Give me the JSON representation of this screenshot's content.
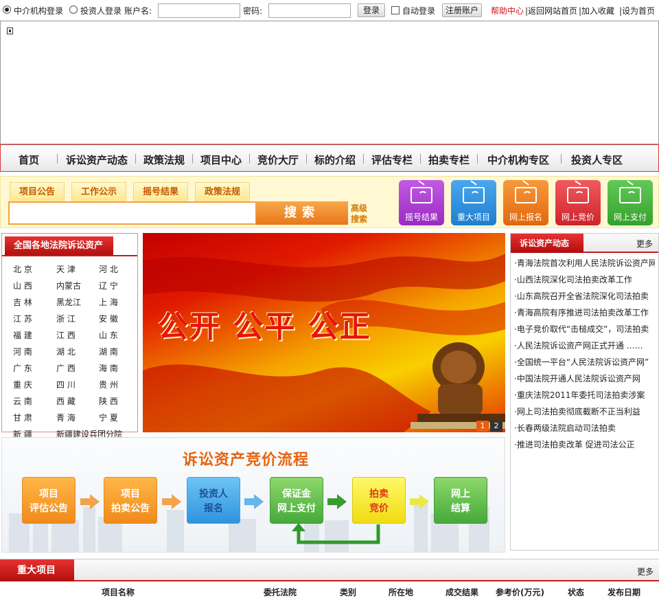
{
  "login": {
    "radio_agency": "中介机构登录",
    "radio_investor": "投资人登录",
    "account_label": "账户名:",
    "password_label": "密码:",
    "login_button": "登录",
    "auto_login": "自动登录",
    "register_button": "注册账户"
  },
  "top_links": [
    "帮助中心",
    "|返回网站首页",
    "|加入收藏",
    "|设为首页"
  ],
  "nav": [
    "首页",
    "诉讼资产动态",
    "政策法规",
    "项目中心",
    "竞价大厅",
    "标的介绍",
    "评估专栏",
    "拍卖专栏",
    "中介机构专区",
    "投资人专区"
  ],
  "search": {
    "tabs": [
      "项目公告",
      "工作公示",
      "摇号结果",
      "政策法规"
    ],
    "button": "搜索",
    "advanced": "高级搜索"
  },
  "quick_buttons": [
    {
      "label": "摇号结果",
      "color": "#b23fd6",
      "icon": "tv-icon"
    },
    {
      "label": "重大项目",
      "color": "#2a8fe0",
      "icon": "tv-icon"
    },
    {
      "label": "网上报名",
      "color": "#f07c1b",
      "icon": "tv-icon"
    },
    {
      "label": "网上竞价",
      "color": "#e0373d",
      "icon": "tv-icon"
    },
    {
      "label": "网上支付",
      "color": "#44b43a",
      "icon": "tv-icon"
    }
  ],
  "region": {
    "title": "全国各地法院诉讼资产",
    "rows": [
      [
        "北 京",
        "天 津",
        "河 北"
      ],
      [
        "山 西",
        "内蒙古",
        "辽 宁"
      ],
      [
        "吉 林",
        "黑龙江",
        "上 海"
      ],
      [
        "江 苏",
        "浙 江",
        "安 徽"
      ],
      [
        "福 建",
        "江 西",
        "山 东"
      ],
      [
        "河 南",
        "湖 北",
        "湖 南"
      ],
      [
        "广 东",
        "广 西",
        "海 南"
      ],
      [
        "重 庆",
        "四 川",
        "贵 州"
      ],
      [
        "云 南",
        "西 藏",
        "陕 西"
      ],
      [
        "甘 肃",
        "青 海",
        "宁 夏"
      ],
      [
        "新 疆",
        "新疆建设兵团分院",
        ""
      ]
    ]
  },
  "banner": {
    "slogan": "公开 公平 公正",
    "pages": [
      "1",
      "2"
    ]
  },
  "news": {
    "title": "诉讼资产动态",
    "more": "更多",
    "items": [
      "·青海法院首次利用人民法院诉讼资产网",
      "·山西法院深化司法拍卖改革工作",
      "·山东高院召开全省法院深化司法拍卖",
      "·青海高院有序推进司法拍卖改革工作",
      "·电子竞价取代“击槌成交”，司法拍卖",
      "·人民法院诉讼资产网正式开通 ……",
      "·全国统一平台“人民法院诉讼资产网”",
      "·中国法院开通人民法院诉讼资产网",
      "·重庆法院2011年委托司法拍卖涉案",
      "·网上司法拍卖彻底截断不正当利益",
      "·长春两级法院启动司法拍卖",
      "·推进司法拍卖改革 促进司法公正"
    ]
  },
  "process": {
    "title": "诉讼资产竞价流程",
    "steps": [
      {
        "label": "项目评估公告",
        "color": "#f39a2a"
      },
      {
        "label": "项目拍卖公告",
        "color": "#f39a2a"
      },
      {
        "label": "投资人报名",
        "color": "#3aa6ea"
      },
      {
        "label": "保证金网上支付",
        "color": "#4fb94a"
      },
      {
        "label": "拍卖竞价",
        "color": "#f4e62e"
      },
      {
        "label": "网上结算",
        "color": "#58c248"
      }
    ]
  },
  "major": {
    "title": "重大项目",
    "more": "更多",
    "columns": [
      "项目名称",
      "委托法院",
      "类别",
      "所在地",
      "成交结果",
      "参考价(万元)",
      "状态",
      "发布日期"
    ]
  }
}
